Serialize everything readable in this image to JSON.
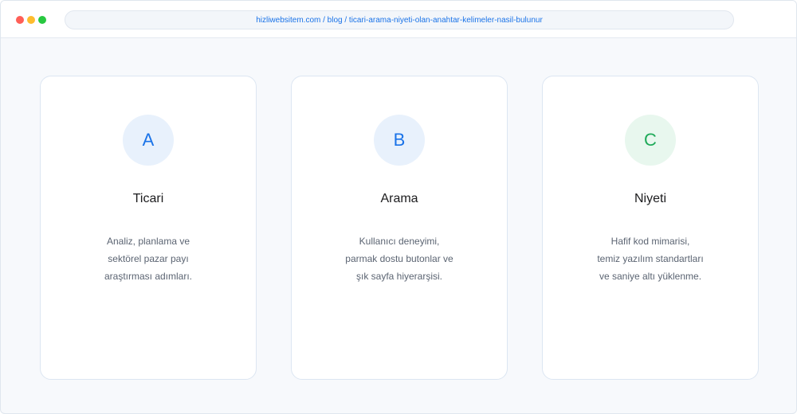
{
  "browser": {
    "url": "hizliwebsitem.com / blog / ticari-arama-niyeti-olan-anahtar-kelimeler-nasil-bulunur"
  },
  "cards": [
    {
      "letter": "A",
      "title": "Ticari",
      "lines": [
        "Analiz, planlama ve",
        "sektörel pazar payı",
        "araştırması adımları."
      ]
    },
    {
      "letter": "B",
      "title": "Arama",
      "lines": [
        "Kullanıcı deneyimi,",
        "parmak dostu butonlar ve",
        "şık sayfa hiyerarşisi."
      ]
    },
    {
      "letter": "C",
      "title": "Niyeti",
      "lines": [
        "Hafif kod mimarisi,",
        "temiz yazılım standartları",
        "ve saniye altı yüklenme."
      ]
    }
  ],
  "colors": {
    "accent_blue": "#1a73e8",
    "accent_green": "#1faa59"
  }
}
